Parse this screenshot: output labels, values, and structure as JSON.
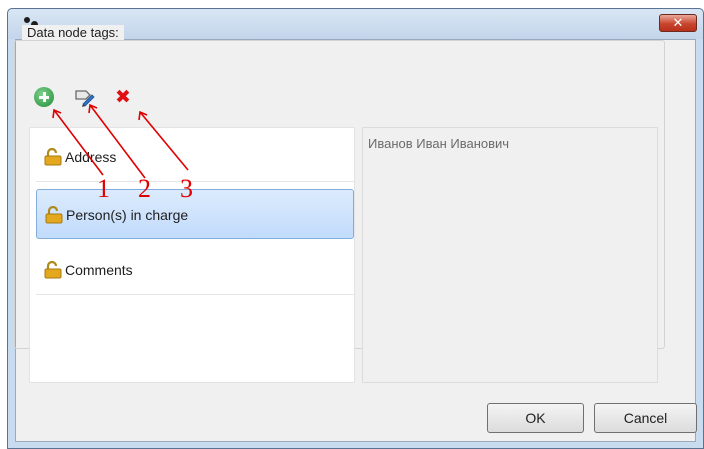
{
  "window": {
    "close_glyph": "✕",
    "accent": "#c9452d"
  },
  "tags_group": {
    "label": "Data node tags:"
  },
  "toolbar": {
    "add_icon": "plus-circle",
    "edit_icon": "tag-edit",
    "delete_icon": "cross",
    "delete_glyph": "✖"
  },
  "tags": [
    {
      "label": "Address"
    },
    {
      "label": "Person(s) in charge",
      "selected": true
    },
    {
      "label": "Comments"
    }
  ],
  "preview": {
    "text": "Иванов Иван Иванович"
  },
  "buttons": {
    "ok": "OK",
    "cancel": "Cancel"
  },
  "annotations": {
    "one": "1",
    "two": "2",
    "three": "3",
    "color": "#e00000"
  }
}
